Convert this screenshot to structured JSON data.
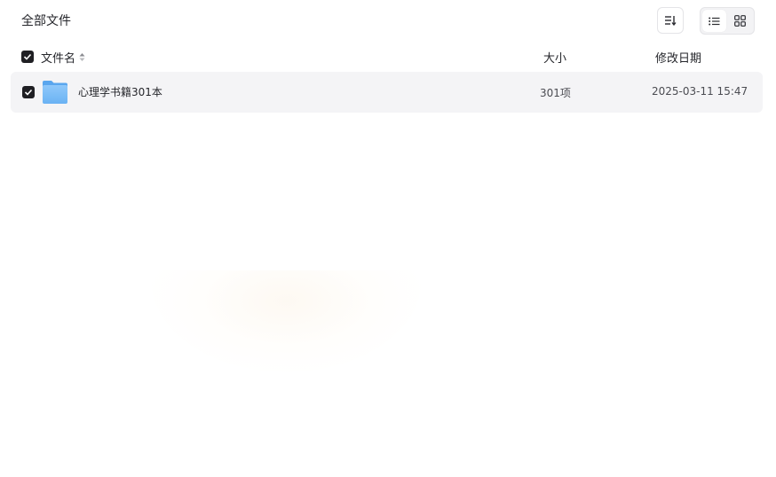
{
  "breadcrumb": {
    "label": "全部文件"
  },
  "toolbar": {
    "sort_icon": "sort-icon",
    "view_modes": [
      "list-view-icon",
      "grid-view-icon"
    ],
    "active_view": "list"
  },
  "table": {
    "columns": {
      "name": "文件名",
      "size": "大小",
      "date": "修改日期"
    },
    "rows": [
      {
        "icon": "folder-icon",
        "name": "心理学书籍301本",
        "size": "301项",
        "modified": "2025-03-11 15:47",
        "checked": true
      }
    ],
    "select_all_checked": true
  },
  "colors": {
    "accent_dark": "#1f1f23",
    "row_highlight": "#f4f4f6",
    "folder_blue": "#7cbcf6"
  }
}
